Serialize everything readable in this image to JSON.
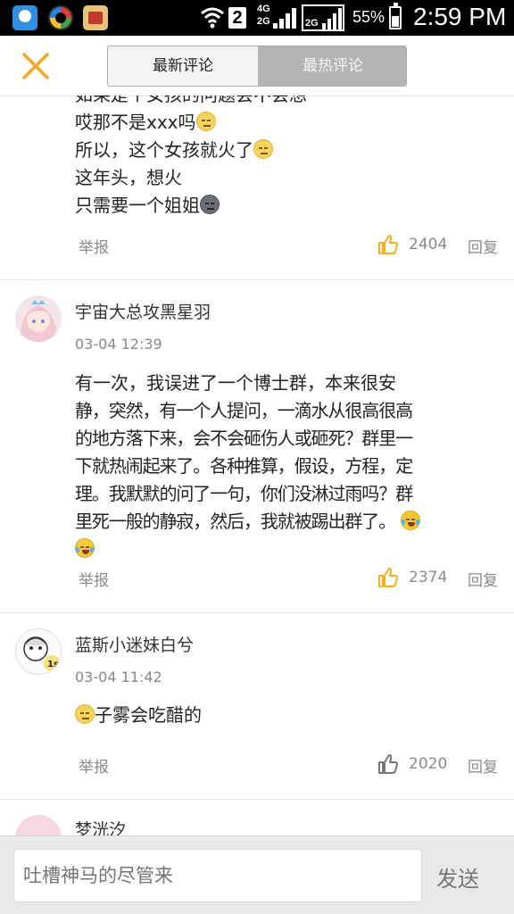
{
  "status_bar": {
    "network_sim": "2",
    "network_type_top": "4G",
    "network_type_bottom": "2G",
    "network_type_2": "2G",
    "battery_percent": "55%",
    "battery_level": 0.55,
    "time": "2:59 PM"
  },
  "header": {
    "tabs": [
      {
        "label": "最新评论",
        "selected": true
      },
      {
        "label": "最热评论",
        "selected": false
      }
    ]
  },
  "comments": [
    {
      "lines": [
        "如果是个女孩的问题会不会想",
        "哎那不是xxx吗",
        "所以，这个女孩就火了",
        "这年头，想火",
        "只需要一个姐姐"
      ],
      "report": "举报",
      "likes": "2404",
      "reply": "回复"
    },
    {
      "username": "宇宙大总攻黑星羽",
      "date": "03-04 12:39",
      "lines": [
        "有一次，我误进了一个博士群，本来很安",
        "静，突然，有一个人提问，一滴水从很高很高",
        "的地方落下来，会不会砸伤人或砸死？群里一",
        "下就热闹起来了。各种推算，假设，方程，定",
        "理。我默默的问了一句，你们没淋过雨吗？群",
        "里死一般的静寂，然后，我就被踢出群了。"
      ],
      "report": "举报",
      "likes": "2374",
      "reply": "回复"
    },
    {
      "username": "蓝斯小迷妹白兮",
      "date": "03-04 11:42",
      "avatar_badge": "1s",
      "lines": [
        "子雾会吃醋的"
      ],
      "report": "举报",
      "likes": "2020",
      "reply": "回复"
    },
    {
      "username": "梦洸汐"
    }
  ],
  "input": {
    "placeholder": "吐槽神马的尽管来",
    "send_label": "发送"
  },
  "colors": {
    "accent": "#f5a623",
    "like_icon": "#f5b021",
    "tab_selected_bg": "#f4f4f4",
    "tab_unselected_bg": "#b4b4b4"
  }
}
